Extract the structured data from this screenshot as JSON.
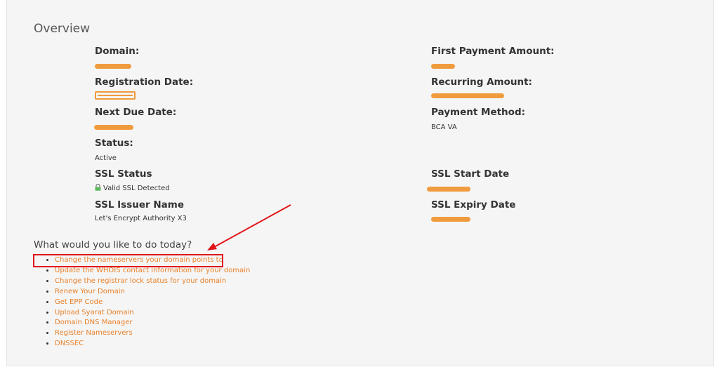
{
  "overview": {
    "title": "Overview",
    "left": [
      {
        "label": "Domain:",
        "value": ""
      },
      {
        "label": "Registration Date:",
        "value": ""
      },
      {
        "label": "Next Due Date:",
        "value": ""
      },
      {
        "label": "Status:",
        "value": "Active"
      },
      {
        "label": "SSL Status",
        "value": "Valid SSL Detected"
      },
      {
        "label": "SSL Issuer Name",
        "value": "Let's Encrypt Authority X3"
      }
    ],
    "right": [
      {
        "label": "First Payment Amount:",
        "value": ""
      },
      {
        "label": "Recurring Amount:",
        "value": ""
      },
      {
        "label": "Payment Method:",
        "value": "BCA VA"
      },
      {
        "label": "SSL Start Date",
        "value": ""
      },
      {
        "label": "SSL Expiry Date",
        "value": ""
      }
    ]
  },
  "actions": {
    "heading": "What would you like to do today?",
    "items": [
      "Change the nameservers your domain points to",
      "Update the WHOIS contact information for your domain",
      "Change the registrar lock status for your domain",
      "Renew Your Domain",
      "Get EPP Code",
      "Upload Syarat Domain",
      "Domain DNS Manager",
      "Register Nameservers",
      "DNSSEC"
    ]
  },
  "colors": {
    "link": "#e8812a",
    "redaction": "#f0912a",
    "annotation": "#e0161a",
    "ssl_lock": "#5cb85c"
  },
  "icons": [
    "lock-icon",
    "annotation-arrow",
    "redaction-mark"
  ]
}
